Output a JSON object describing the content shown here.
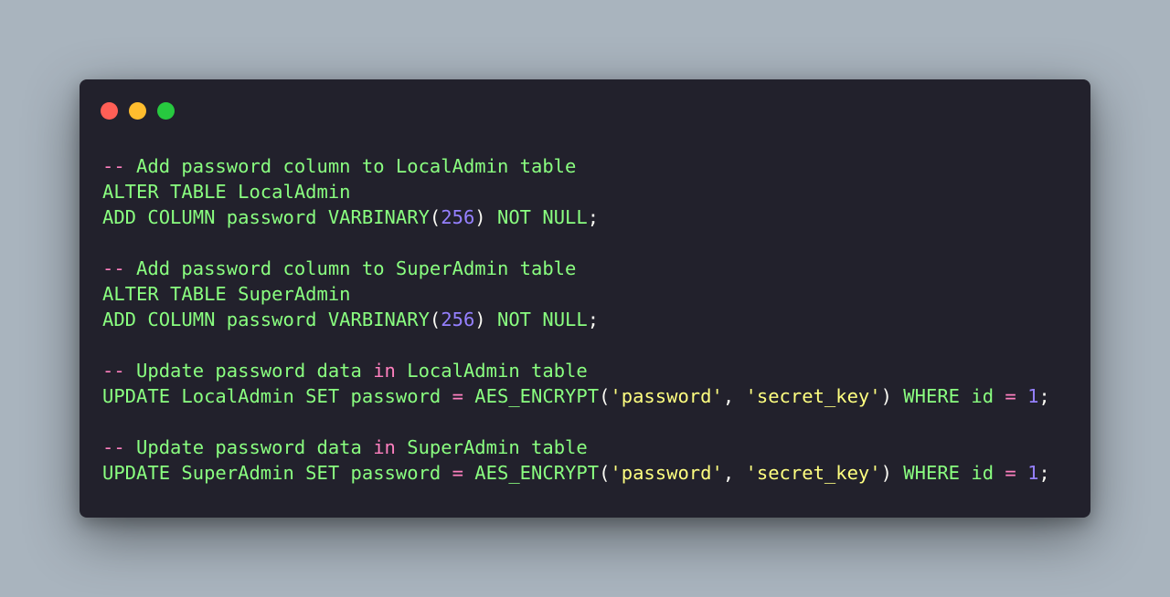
{
  "colors": {
    "background": "#a9b4be",
    "window": "#22212c",
    "close": "#ff5f56",
    "minimize": "#ffbd2e",
    "maximize": "#27c93f",
    "keyword": "#8aff80",
    "comment_marker": "#ff80bf",
    "number": "#9580ff",
    "string": "#ffff80",
    "punctuation": "#f8f8f2"
  },
  "window_controls": [
    "close-icon",
    "minimize-icon",
    "maximize-icon"
  ],
  "code": {
    "lines": [
      [
        [
          "comment-dash",
          "--"
        ],
        [
          "comment",
          " Add password column to LocalAdmin table"
        ]
      ],
      [
        [
          "keyword",
          "ALTER TABLE LocalAdmin"
        ]
      ],
      [
        [
          "keyword",
          "ADD COLUMN password VARBINARY"
        ],
        [
          "punct",
          "("
        ],
        [
          "number",
          "256"
        ],
        [
          "punct",
          ")"
        ],
        [
          "keyword",
          " NOT NULL"
        ],
        [
          "punct",
          ";"
        ]
      ],
      [],
      [
        [
          "comment-dash",
          "--"
        ],
        [
          "comment",
          " Add password column to SuperAdmin table"
        ]
      ],
      [
        [
          "keyword",
          "ALTER TABLE SuperAdmin"
        ]
      ],
      [
        [
          "keyword",
          "ADD COLUMN password VARBINARY"
        ],
        [
          "punct",
          "("
        ],
        [
          "number",
          "256"
        ],
        [
          "punct",
          ")"
        ],
        [
          "keyword",
          " NOT NULL"
        ],
        [
          "punct",
          ";"
        ]
      ],
      [],
      [
        [
          "comment-dash",
          "--"
        ],
        [
          "comment",
          " Update password data "
        ],
        [
          "kw-pink",
          "in"
        ],
        [
          "comment",
          " LocalAdmin table"
        ]
      ],
      [
        [
          "keyword",
          "UPDATE LocalAdmin SET password "
        ],
        [
          "op",
          "="
        ],
        [
          "keyword",
          " AES_ENCRYPT"
        ],
        [
          "punct",
          "("
        ],
        [
          "string",
          "'password'"
        ],
        [
          "punct",
          ", "
        ],
        [
          "string",
          "'secret_key'"
        ],
        [
          "punct",
          ")"
        ],
        [
          "keyword",
          " WHERE id "
        ],
        [
          "op",
          "="
        ],
        [
          "punct",
          " "
        ],
        [
          "number",
          "1"
        ],
        [
          "punct",
          ";"
        ]
      ],
      [],
      [
        [
          "comment-dash",
          "--"
        ],
        [
          "comment",
          " Update password data "
        ],
        [
          "kw-pink",
          "in"
        ],
        [
          "comment",
          " SuperAdmin table"
        ]
      ],
      [
        [
          "keyword",
          "UPDATE SuperAdmin SET password "
        ],
        [
          "op",
          "="
        ],
        [
          "keyword",
          " AES_ENCRYPT"
        ],
        [
          "punct",
          "("
        ],
        [
          "string",
          "'password'"
        ],
        [
          "punct",
          ", "
        ],
        [
          "string",
          "'secret_key'"
        ],
        [
          "punct",
          ")"
        ],
        [
          "keyword",
          " WHERE id "
        ],
        [
          "op",
          "="
        ],
        [
          "punct",
          " "
        ],
        [
          "number",
          "1"
        ],
        [
          "punct",
          ";"
        ]
      ]
    ]
  }
}
